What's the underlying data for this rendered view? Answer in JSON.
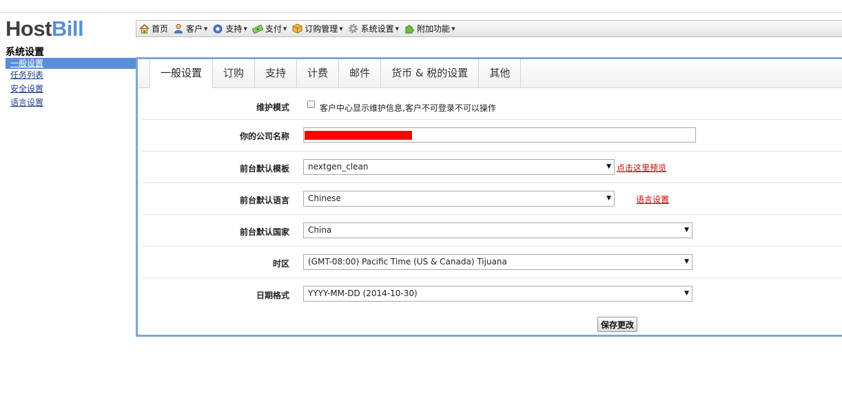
{
  "logo": {
    "part1": "Host",
    "part2": "Bill"
  },
  "page_title": "系统设置",
  "sidebar": {
    "items": [
      {
        "label": "一般设置",
        "active": true
      },
      {
        "label": "任务列表",
        "active": false
      },
      {
        "label": "安全设置",
        "active": false
      },
      {
        "label": "语言设置",
        "active": false
      }
    ]
  },
  "menu": {
    "items": [
      {
        "label": "首页",
        "icon": "home-icon",
        "dropdown": false
      },
      {
        "label": "客户",
        "icon": "user-icon",
        "dropdown": true
      },
      {
        "label": "支持",
        "icon": "support-icon",
        "dropdown": true
      },
      {
        "label": "支付",
        "icon": "money-icon",
        "dropdown": true
      },
      {
        "label": "订购管理",
        "icon": "box-icon",
        "dropdown": true
      },
      {
        "label": "系统设置",
        "icon": "gear-icon",
        "dropdown": true
      },
      {
        "label": "附加功能",
        "icon": "puzzle-icon",
        "dropdown": true
      }
    ]
  },
  "tabs": [
    {
      "label": "一般设置",
      "active": true
    },
    {
      "label": "订购",
      "active": false
    },
    {
      "label": "支持",
      "active": false
    },
    {
      "label": "计费",
      "active": false
    },
    {
      "label": "邮件",
      "active": false
    },
    {
      "label": "货币 & 税的设置",
      "active": false
    },
    {
      "label": "其他",
      "active": false
    }
  ],
  "form": {
    "maintenance": {
      "label": "维护模式",
      "checkbox_label": "客户中心显示维护信息,客户不可登录不可以操作",
      "checked": false
    },
    "company": {
      "label": "你的公司名称",
      "value": ""
    },
    "template": {
      "label": "前台默认模板",
      "value": "nextgen_clean",
      "link": "点击这里预览"
    },
    "language": {
      "label": "前台默认语言",
      "value": "Chinese",
      "link": "语言设置"
    },
    "country": {
      "label": "前台默认国家",
      "value": "China"
    },
    "timezone": {
      "label": "时区",
      "value": "(GMT-08:00) Pacific Time (US & Canada) Tijuana"
    },
    "date_format": {
      "label": "日期格式",
      "value": "YYYY-MM-DD (2014-10-30)"
    }
  },
  "save_label": "保存更改",
  "colors": {
    "accent": "#5b8ed8",
    "panel_border": "#7ea6d8",
    "link_red": "#cc0000"
  }
}
